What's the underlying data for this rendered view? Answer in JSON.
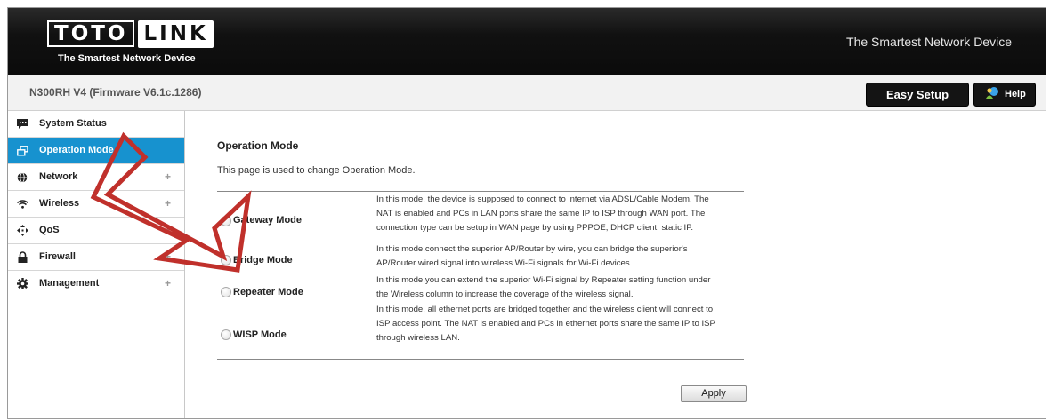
{
  "brand": {
    "logo_part1": "TOTO",
    "logo_part2": "LINK",
    "logo_tagline": "The Smartest Network Device",
    "header_tagline": "The Smartest Network Device"
  },
  "subbar": {
    "model": "N300RH V4 (Firmware V6.1c.1286)",
    "easy_setup": "Easy Setup",
    "help": "Help"
  },
  "sidebar": {
    "items": [
      {
        "label": "System Status",
        "icon": "chat-icon",
        "plus": ""
      },
      {
        "label": "Operation Mode",
        "icon": "window-icon",
        "plus": "",
        "active": true
      },
      {
        "label": "Network",
        "icon": "globe-icon",
        "plus": "+"
      },
      {
        "label": "Wireless",
        "icon": "wifi-icon",
        "plus": "+"
      },
      {
        "label": "QoS",
        "icon": "arrows-icon",
        "plus": "+"
      },
      {
        "label": "Firewall",
        "icon": "lock-icon",
        "plus": "+"
      },
      {
        "label": "Management",
        "icon": "gear-icon",
        "plus": "+"
      }
    ]
  },
  "main": {
    "title": "Operation Mode",
    "description": "This page is used to change Operation Mode.",
    "modes": [
      {
        "label": "Gateway Mode",
        "lines": [
          "In this mode, the device is supposed to connect to internet via ADSL/Cable Modem. The",
          "NAT is enabled and PCs in LAN ports share the same IP to ISP through WAN port. The",
          "connection type can be setup in WAN page by using PPPOE, DHCP client, static IP."
        ]
      },
      {
        "label": "Bridge Mode",
        "lines": [
          "In this mode,connect the superior AP/Router by wire, you can bridge the superior's",
          "AP/Router wired signal into wireless Wi-Fi signals for Wi-Fi devices."
        ]
      },
      {
        "label": "Repeater Mode",
        "lines": [
          "In this mode,you can extend the superior Wi-Fi signal by Repeater setting function under",
          "the Wireless column to increase the coverage of the wireless signal."
        ]
      },
      {
        "label": "WISP Mode",
        "lines": [
          "In this mode, all ethernet ports are bridged together and the wireless client will connect to",
          "ISP access point. The NAT is enabled and PCs in ethernet ports share the same IP to ISP",
          "through wireless LAN."
        ]
      }
    ],
    "apply": "Apply"
  },
  "colors": {
    "accent": "#1792cf",
    "annotation_arrow": "#c0302b"
  }
}
